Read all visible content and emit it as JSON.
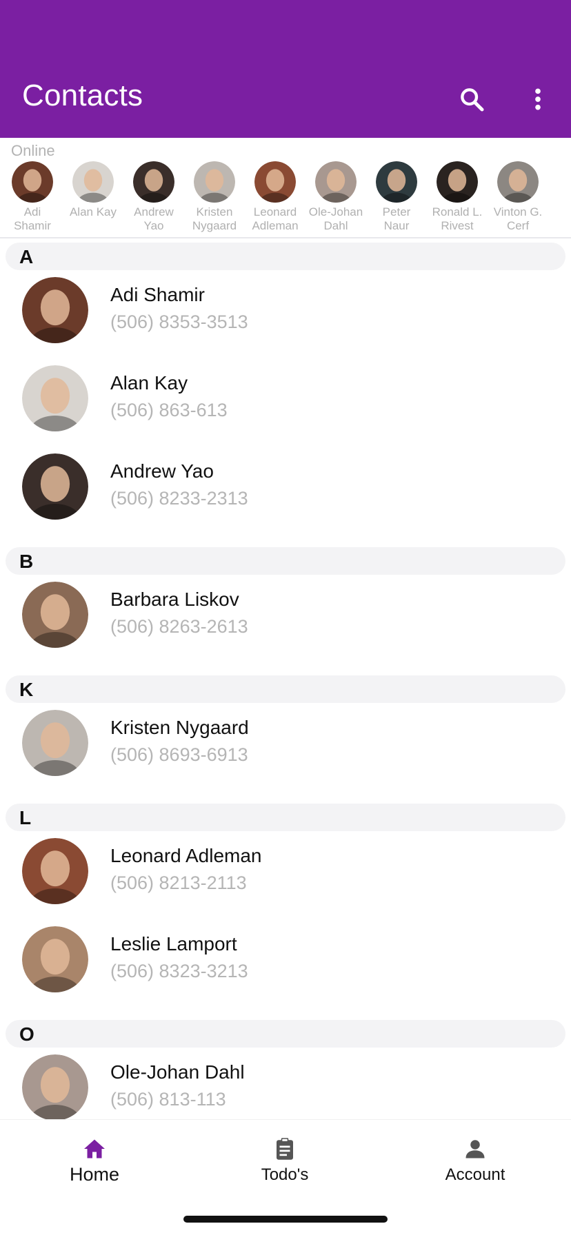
{
  "colors": {
    "primary": "#7b1fa2",
    "section_bg": "#f3f3f5",
    "phone_text": "#b5b5b5",
    "online_text": "#b0b0b0"
  },
  "appbar": {
    "title": "Contacts",
    "search_icon": "search-icon",
    "more_icon": "more-vert-icon"
  },
  "online": {
    "label": "Online",
    "people": [
      {
        "name": "Adi\nShamir",
        "line1": "Adi",
        "line2": "Shamir",
        "tone": "#6b3b2a"
      },
      {
        "name": "Alan Kay",
        "line1": "Alan Kay",
        "line2": "",
        "tone": "#d8d4cf"
      },
      {
        "name": "Andrew Yao",
        "line1": "Andrew",
        "line2": "Yao",
        "tone": "#3a2e2a"
      },
      {
        "name": "Kristen Nygaard",
        "line1": "Kristen",
        "line2": "Nygaard",
        "tone": "#bdb7b1"
      },
      {
        "name": "Leonard Adleman",
        "line1": "Leonard",
        "line2": "Adleman",
        "tone": "#8a4a33"
      },
      {
        "name": "Ole-Johan Dahl",
        "line1": "Ole-Johan",
        "line2": "Dahl",
        "tone": "#a89890"
      },
      {
        "name": "Peter Naur",
        "line1": "Peter",
        "line2": "Naur",
        "tone": "#2e3b3f"
      },
      {
        "name": "Ronald L. Rivest",
        "line1": "Ronald L.",
        "line2": "Rivest",
        "tone": "#2a2320"
      },
      {
        "name": "Vinton G. Cerf",
        "line1": "Vinton G.",
        "line2": "Cerf",
        "tone": "#8c8782"
      }
    ]
  },
  "sections": [
    {
      "letter": "A",
      "contacts": [
        {
          "name": "Adi Shamir",
          "phone": "(506) 8353-3513",
          "tone": "#6b3b2a"
        },
        {
          "name": "Alan Kay",
          "phone": "(506) 863-613",
          "tone": "#d8d4cf"
        },
        {
          "name": "Andrew Yao",
          "phone": "(506) 8233-2313",
          "tone": "#3a2e2a"
        }
      ]
    },
    {
      "letter": "B",
      "contacts": [
        {
          "name": "Barbara Liskov",
          "phone": "(506) 8263-2613",
          "tone": "#8a6a55"
        }
      ]
    },
    {
      "letter": "K",
      "contacts": [
        {
          "name": "Kristen Nygaard",
          "phone": "(506) 8693-6913",
          "tone": "#bdb7b1"
        }
      ]
    },
    {
      "letter": "L",
      "contacts": [
        {
          "name": "Leonard Adleman",
          "phone": "(506) 8213-2113",
          "tone": "#8a4a33"
        },
        {
          "name": "Leslie Lamport",
          "phone": "(506) 8323-3213",
          "tone": "#a9856a"
        }
      ]
    },
    {
      "letter": "O",
      "contacts": [
        {
          "name": "Ole-Johan Dahl",
          "phone": "(506) 813-113",
          "tone": "#a89890"
        }
      ]
    }
  ],
  "bottom_nav": {
    "home": {
      "label": "Home",
      "icon": "home-icon"
    },
    "todos": {
      "label": "Todo's",
      "icon": "clipboard-icon"
    },
    "account": {
      "label": "Account",
      "icon": "person-icon"
    }
  }
}
